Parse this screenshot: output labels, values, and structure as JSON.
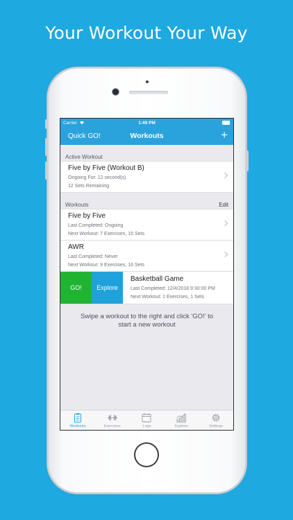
{
  "promo": {
    "headline": "Your Workout Your Way"
  },
  "status_bar": {
    "carrier": "Carrier",
    "time": "1:49 PM"
  },
  "nav": {
    "left_button": "Quick GO!",
    "title": "Workouts",
    "add_icon": "plus-icon",
    "add_symbol": "+"
  },
  "active_section": {
    "header": "Active Workout",
    "item": {
      "name": "Five by Five (Workout B)",
      "line1": "Ongoing For: 12 second(s)",
      "line2": "12 Sets Remaining"
    }
  },
  "workouts_section": {
    "header": "Workouts",
    "edit_label": "Edit",
    "items": [
      {
        "name": "Five by Five",
        "line1": "Last Completed: Ongoing",
        "line2": "Next Workout: 7 Exercises, 15 Sets"
      },
      {
        "name": "AWR",
        "line1": "Last Completed: Never",
        "line2": "Next Workout: 9 Exercises, 16 Sets"
      }
    ],
    "swiped_item": {
      "go_label": "GO!",
      "explore_label": "Explore",
      "name": "Basketball Game",
      "line1": "Last Completed: 12/4/2018 9:30:00 PM",
      "line2": "Next Workout: 1 Exercises, 1 Sets"
    }
  },
  "hint": "Swipe a workout to the right and click 'GO!' to start a new workout",
  "tab_bar": {
    "tabs": [
      {
        "label": "Workouts",
        "icon": "clipboard-icon",
        "active": true
      },
      {
        "label": "Exercises",
        "icon": "dumbbell-icon",
        "active": false
      },
      {
        "label": "Logs",
        "icon": "calendar-icon",
        "active": false
      },
      {
        "label": "Explore",
        "icon": "bar-chart-icon",
        "active": false
      },
      {
        "label": "Settings",
        "icon": "gear-icon",
        "active": false
      }
    ]
  },
  "colors": {
    "background": "#1ea9e1",
    "nav": "#2aa3dd",
    "go": "#20b433",
    "explore": "#1fa2dc"
  }
}
